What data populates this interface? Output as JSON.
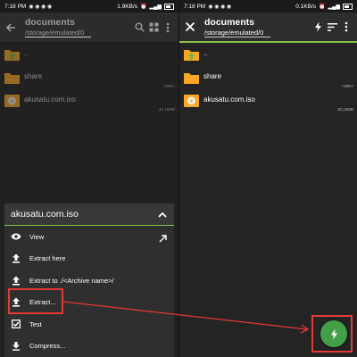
{
  "left": {
    "status": {
      "time": "7:18 PM",
      "speed": "1.9KB/s"
    },
    "title": "documents",
    "path": "/storage/emulated/0",
    "items": [
      {
        "name": "..",
        "meta": ""
      },
      {
        "name": "share",
        "meta": "<DIR>"
      },
      {
        "name": "akusatu.com.iso",
        "meta": "30.15MB"
      }
    ],
    "sheet": {
      "title": "akusatu.com.iso",
      "items": [
        {
          "label": "View"
        },
        {
          "label": "Extract here"
        },
        {
          "label": "Extract to ./<Archive name>/"
        },
        {
          "label": "Extract..."
        },
        {
          "label": "Test"
        },
        {
          "label": "Compress..."
        }
      ]
    }
  },
  "right": {
    "status": {
      "time": "7:18 PM",
      "speed": "0.1KB/s"
    },
    "title": "documents",
    "path": "/storage/emulated/0",
    "items": [
      {
        "name": "..",
        "meta": ""
      },
      {
        "name": "share",
        "meta": "<DIR>"
      },
      {
        "name": "akusatu.com.iso",
        "meta": "30.15MB"
      }
    ]
  },
  "colors": {
    "accent": "#8bc34a",
    "fab": "#43a047",
    "highlight": "#e53935",
    "folder": "#f9a825"
  }
}
